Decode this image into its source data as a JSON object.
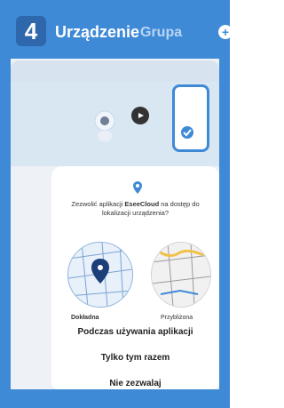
{
  "step_badge": "4",
  "header": {
    "tab_device": "Urządzenie",
    "tab_group": "Grupa"
  },
  "dialog": {
    "question_prefix": "Zezwolić aplikacji ",
    "app_name": "EseeCloud",
    "question_suffix": " na dostęp do lokalizacji urządzenia?",
    "precise_label": "Dokładna",
    "approx_label": "Przybliżona",
    "option_while_using": "Podczas używania aplikacji",
    "option_only_once": "Tylko tym razem",
    "option_deny": "Nie zezwalaj"
  },
  "colors": {
    "accent": "#3f8ad6",
    "badge": "#2f67ad"
  }
}
